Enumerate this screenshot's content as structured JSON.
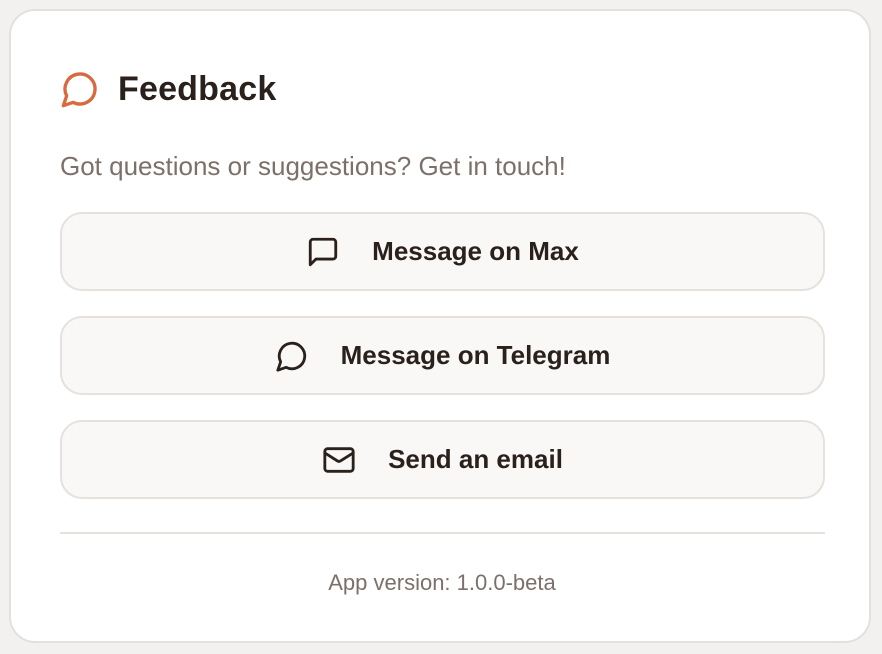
{
  "feedback": {
    "title": "Feedback",
    "title_icon": "speech-bubble-icon",
    "accent_color": "#d9693f",
    "subtitle": "Got questions or suggestions? Get in touch!",
    "buttons": [
      {
        "label": "Message on Max",
        "icon": "message-square-icon"
      },
      {
        "label": "Message on Telegram",
        "icon": "speech-bubble-icon"
      },
      {
        "label": "Send an email",
        "icon": "mail-icon"
      }
    ],
    "version_text": "App version: 1.0.0-beta"
  }
}
